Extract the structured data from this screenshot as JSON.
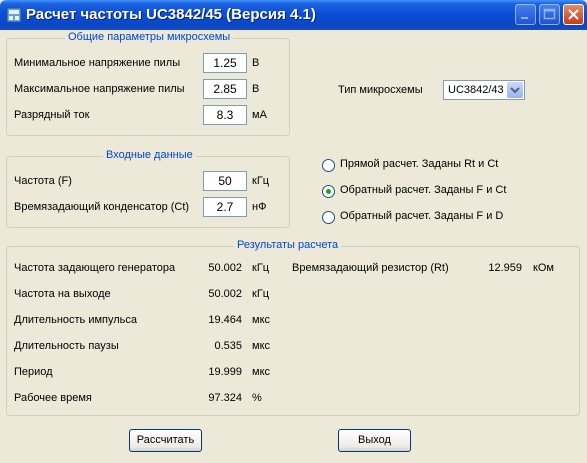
{
  "window": {
    "title": "Расчет частоты UC3842/45 (Версия 4.1)"
  },
  "chip_params": {
    "group_title": "Общие параметры микросхемы",
    "min_voltage": {
      "label": "Минимальное напряжение пилы",
      "value": "1.25",
      "unit": "В"
    },
    "max_voltage": {
      "label": "Максимальное напряжение пилы",
      "value": "2.85",
      "unit": "В"
    },
    "discharge_current": {
      "label": "Разрядный ток",
      "value": "8.3",
      "unit": "мА"
    }
  },
  "chip_type": {
    "label": "Тип микросхемы",
    "selected": "UC3842/43"
  },
  "input_data": {
    "group_title": "Входные данные",
    "frequency": {
      "label": "Частота (F)",
      "value": "50",
      "unit": "кГц"
    },
    "capacitor": {
      "label": "Времязадающий конденсатор (Ct)",
      "value": "2.7",
      "unit": "нФ"
    }
  },
  "modes": [
    {
      "label": "Прямой расчет. Заданы Rt и Ct",
      "selected": false
    },
    {
      "label": "Обратный расчет. Заданы F и Ct",
      "selected": true
    },
    {
      "label": "Обратный расчет. Заданы F и D",
      "selected": false
    }
  ],
  "results": {
    "group_title": "Результаты расчета",
    "rows": [
      {
        "label": "Частота задающего генератора",
        "value": "50.002",
        "unit": "кГц"
      },
      {
        "label": "Частота на выходе",
        "value": "50.002",
        "unit": "кГц"
      },
      {
        "label": "Длительность импульса",
        "value": "19.464",
        "unit": "мкс"
      },
      {
        "label": "Длительность паузы",
        "value": "0.535",
        "unit": "мкс"
      },
      {
        "label": "Период",
        "value": "19.999",
        "unit": "мкс"
      },
      {
        "label": "Рабочее время",
        "value": "97.324",
        "unit": "%"
      }
    ],
    "resistor": {
      "label": "Времязадающий резистор (Rt)",
      "value": "12.959",
      "unit": "кОм"
    }
  },
  "buttons": {
    "calculate": "Рассчитать",
    "exit": "Выход"
  },
  "colors": {
    "titlebar": "#0a4fd8",
    "group_title": "#0046d5",
    "background": "#ece9d8",
    "radio_selected": "#21a121"
  }
}
